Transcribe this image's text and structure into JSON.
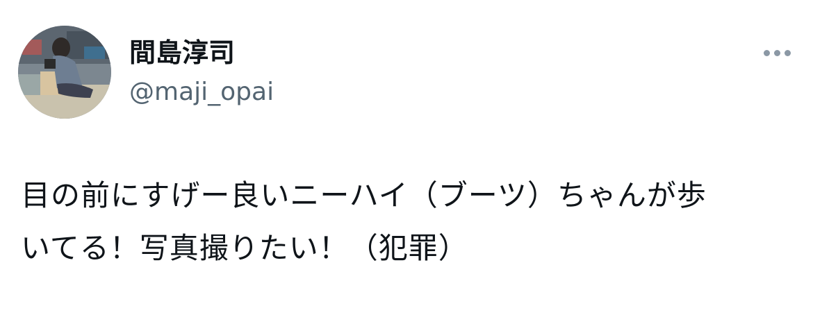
{
  "author": {
    "display_name": "間島淳司",
    "handle": "@maji_opai",
    "avatar_icon": "profile-photo"
  },
  "menu": {
    "more_icon": "ellipsis-icon",
    "dot_color": "#8b98a5"
  },
  "tweet": {
    "text_lines": [
      "目の前にすげー良いニーハイ（ブーツ）ちゃんが歩",
      "いてる！写真撮りたい！（犯罪）"
    ]
  },
  "colors": {
    "text_primary": "#0f1419",
    "text_secondary": "#536471"
  }
}
